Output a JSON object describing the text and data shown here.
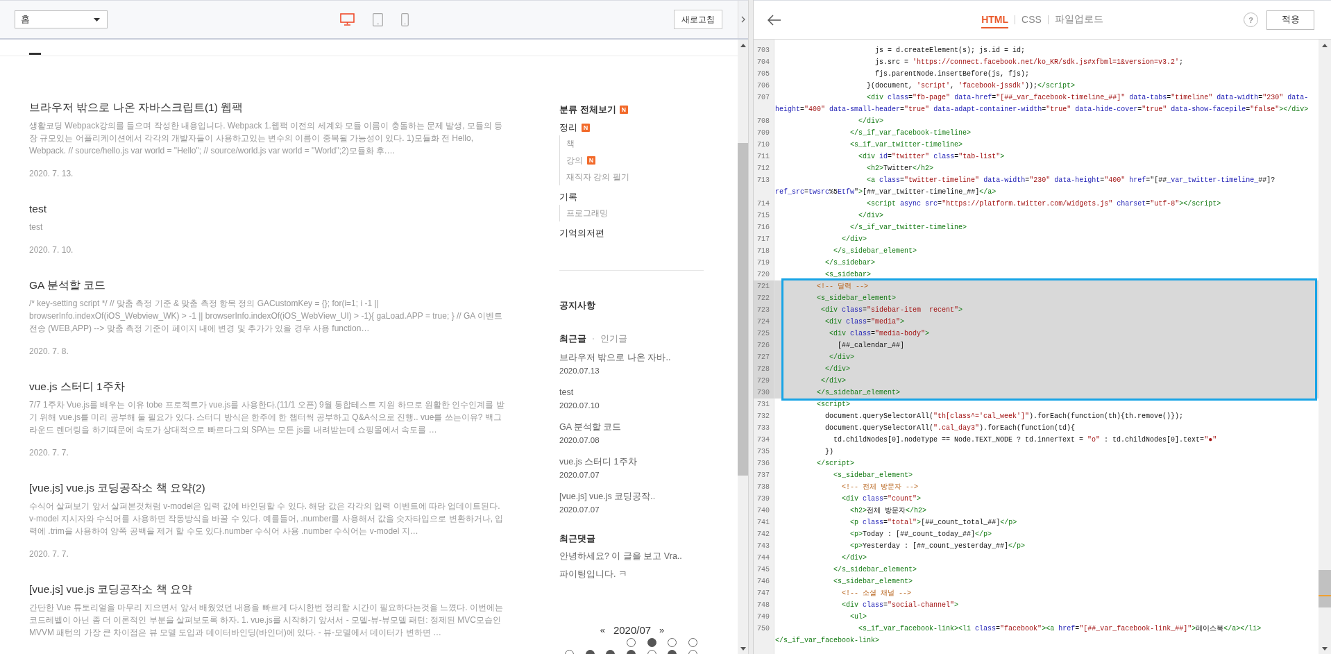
{
  "preview": {
    "page_select": {
      "value": "홈"
    },
    "devices": [
      {
        "kind": "desktop",
        "selected": true
      },
      {
        "kind": "tablet",
        "selected": false
      },
      {
        "kind": "mobile",
        "selected": false
      }
    ],
    "refresh_button": "새로고침",
    "posts": [
      {
        "title": "브라우저 밖으로 나온 자바스크립트(1) 웹팩",
        "excerpt": "생활코딩 Webpack강의를 들으며 작성한 내용입니다. Webpack 1.웹팩 이전의 세계와 모듈 이름이 충돌하는 문제 발생, 모듈의 등장 규모있는 어플리케이션에서 각각의 개발자들이 사용하고있는 변수의 이름이 중복될 가능성이 있다. 1)모듈화 전 Hello, Webpack. // source/hello.js var world = \"Hello\"; // source/world.js var world = \"World\";2)모듈화 후.…",
        "date": "2020. 7. 13."
      },
      {
        "title": "test",
        "excerpt": "test",
        "date": "2020. 7. 10."
      },
      {
        "title": "GA 분석할 코드",
        "excerpt": "/* key-setting script */ // 맞춤 측정 기준 & 맞춤 측정 항목 정의 GACustomKey = {}; for(i=1; i -1 || browserInfo.indexOf(iOS_Webview_WK) > -1 || browserInfo.indexOf(iOS_WebView_UI) > -1){ gaLoad.APP = true; } // GA 이벤트 전송 (WEB,APP) --> 맞춤 측정 기준이 페이지 내에 변경 및 추가가 있을 경우 사용 function…",
        "date": "2020. 7. 8."
      },
      {
        "title": "vue.js 스터디 1주차",
        "excerpt": "7/7 1주차 Vue.js를 배우는 이유 tobe 프로젝트가 vue.js를 사용한다.(11/1 오픈) 9월 통합테스트 지원 하므로 원활한 인수인계를 받기 위해 vue.js를 미리 공부해 둘 필요가 있다. 스터디 방식은 한주에 한 챕터씩 공부하고 Q&A식으로 진행.. vue를 쓰는이유? 백그라운드 렌더링을 하기때문에 속도가 상대적으로 빠르다그외 SPA는 모든 js를 내려받는데 쇼핑몰에서 속도를 …",
        "date": "2020. 7. 7."
      },
      {
        "title": "[vue.js] vue.js 코딩공작소 책 요약(2)",
        "excerpt": "수식어 살펴보기 앞서 살펴본것처럼 v-model은 입력 값에 바인딩할 수 있다. 해당 값은 각각의 입력 이벤트에 따라 업데이트된다. v-model 지시자와 수식어를 사용하면 작동방식을 바꿀 수 있다. 예를들어, .number를 사용해서 값을 숫자타입으로 변환하거나, 입력에 .trim을 사용하여 양쪽 공백을 제거 할 수도 있다.number 수식어 사용 .number 수식어는 v-model 지…",
        "date": "2020. 7. 7."
      },
      {
        "title": "[vue.js] vue.js 코딩공작소 책 요약",
        "excerpt": "간단한 Vue 튜토리얼을 마무리 지으면서 앞서 배웠었던 내용을 빠르게 다시한번 정리할 시간이 필요하다는것을 느꼈다. 이번에는 코드레벨이 아닌 좀 더 이론적인 부분을 살펴보도록 하자. 1. vue.js를 시작하기 앞서서 - 모델-뷰-뷰모델 패턴: 정제된 MVC모습인 MVVM 패턴의 가장 큰 차이점은 뷰 모델 도입과 데이터바인딩(바인더)에 있다. - 뷰-모델에서 데이터가 변하면 …"
      }
    ],
    "sidebar": {
      "category_root": {
        "label": "분류 전체보기",
        "badge": "N"
      },
      "categories": [
        {
          "label": "정리",
          "badge": "N",
          "children": [
            {
              "label": "책"
            },
            {
              "label": "강의",
              "badge": "N"
            },
            {
              "label": "재직자 강의 필기"
            }
          ]
        },
        {
          "label": "기록",
          "children": [
            {
              "label": "프로그래밍"
            }
          ]
        },
        {
          "label": "기억의저편"
        }
      ],
      "notice_heading": "공지사항",
      "post_tabs": [
        {
          "label": "최근글",
          "selected": true
        },
        {
          "label": "인기글",
          "selected": false
        }
      ],
      "recent_posts": [
        {
          "title": "브라우저 밖으로 나온 자바..",
          "date": "2020.07.13"
        },
        {
          "title": "test",
          "date": "2020.07.10"
        },
        {
          "title": "GA 분석할 코드",
          "date": "2020.07.08"
        },
        {
          "title": "vue.js 스터디 1주차",
          "date": "2020.07.07"
        },
        {
          "title": "[vue.js] vue.js 코딩공작..",
          "date": "2020.07.07"
        }
      ],
      "comments_heading": "최근댓글",
      "comments": [
        "안녕하세요? 이 글을 보고 Vra..",
        "파이팅입니다. ㅋ"
      ],
      "calendar": {
        "prev": "«",
        "month": "2020/07",
        "next": "»",
        "weeks": [
          [
            {
              "kind": "blank"
            },
            {
              "kind": "blank"
            },
            {
              "kind": "blank"
            },
            {
              "kind": "day",
              "filled": false
            },
            {
              "kind": "day",
              "filled": true
            },
            {
              "kind": "day",
              "filled": false
            },
            {
              "kind": "day",
              "filled": false
            }
          ],
          [
            {
              "kind": "day",
              "filled": false
            },
            {
              "kind": "day",
              "filled": true
            },
            {
              "kind": "day",
              "filled": true
            },
            {
              "kind": "day",
              "filled": true
            },
            {
              "kind": "day",
              "filled": false
            },
            {
              "kind": "day",
              "filled": true
            },
            {
              "kind": "day",
              "filled": false
            }
          ]
        ]
      }
    }
  },
  "editor": {
    "tabs": [
      {
        "label": "HTML",
        "selected": true
      },
      {
        "label": "CSS",
        "selected": false
      },
      {
        "label": "파일업로드",
        "selected": false
      }
    ],
    "help_button": "?",
    "apply_button": "적용",
    "lines": [
      {
        "number": "703",
        "text": "                        js = d.createElement(s); js.id = id;",
        "selected": false
      },
      {
        "number": "704",
        "text": "                        js.src = 'https://connect.facebook.net/ko_KR/sdk.js#xfbml=1&version=v3.2';",
        "selected": false
      },
      {
        "number": "705",
        "text": "                        fjs.parentNode.insertBefore(js, fjs);",
        "selected": false
      },
      {
        "number": "706",
        "text": "                      }(document, 'script', 'facebook-jssdk'));</script>",
        "selected": false
      },
      {
        "number": "707",
        "text": "                      <div class=\"fb-page\" data-href=\"[##_var_facebook-timeline_##]\" data-tabs=\"timeline\" data-width=\"230\" data-",
        "wrapped": "height=\"400\" data-small-header=\"true\" data-adapt-container-width=\"true\" data-hide-cover=\"true\" data-show-facepile=\"false\"></div>",
        "selected": false
      },
      {
        "number": "708",
        "text": "                    </div>",
        "selected": false
      },
      {
        "number": "709",
        "text": "                  </s_if_var_facebook-timeline>",
        "selected": false
      },
      {
        "number": "710",
        "text": "                  <s_if_var_twitter-timeline>",
        "selected": false
      },
      {
        "number": "711",
        "text": "                    <div id=\"twitter\" class=\"tab-list\">",
        "selected": false
      },
      {
        "number": "712",
        "text": "                      <h2>Twitter</h2>",
        "selected": false
      },
      {
        "number": "713",
        "text": "                      <a class=\"twitter-timeline\" data-width=\"230\" data-height=\"400\" href=\"[##_var_twitter-timeline_##]?",
        "wrapped": "ref_src=twsrc%5Etfw\">[##_var_twitter-timeline_##]</a>",
        "selected": false
      },
      {
        "number": "714",
        "text": "                      <script async src=\"https://platform.twitter.com/widgets.js\" charset=\"utf-8\"></script>",
        "selected": false
      },
      {
        "number": "715",
        "text": "                    </div>",
        "selected": false
      },
      {
        "number": "716",
        "text": "                  </s_if_var_twitter-timeline>",
        "selected": false
      },
      {
        "number": "717",
        "text": "                </div>",
        "selected": false
      },
      {
        "number": "718",
        "text": "              </s_sidebar_element>",
        "selected": false
      },
      {
        "number": "719",
        "text": "            </s_sidebar>",
        "selected": false
      },
      {
        "number": "720",
        "text": "            <s_sidebar>",
        "selected": false
      },
      {
        "number": "721",
        "text": "          <!-- 달력 -->",
        "selected": true,
        "boxed": true
      },
      {
        "number": "722",
        "text": "          <s_sidebar_element>",
        "selected": true,
        "boxed": true
      },
      {
        "number": "723",
        "text": "           <div class=\"sidebar-item  recent\">",
        "selected": true,
        "boxed": true
      },
      {
        "number": "724",
        "text": "            <div class=\"media\">",
        "selected": true,
        "boxed": true
      },
      {
        "number": "725",
        "text": "             <div class=\"media-body\">",
        "selected": true,
        "boxed": true
      },
      {
        "number": "726",
        "text": "               [##_calendar_##]",
        "selected": true,
        "boxed": true
      },
      {
        "number": "727",
        "text": "             </div>",
        "selected": true,
        "boxed": true
      },
      {
        "number": "728",
        "text": "            </div>",
        "selected": true,
        "boxed": true
      },
      {
        "number": "729",
        "text": "           </div>",
        "selected": true,
        "boxed": true
      },
      {
        "number": "730",
        "text": "          </s_sidebar_element>",
        "selected": true,
        "boxed": true
      },
      {
        "number": "731",
        "text": "          <script>",
        "selected": false
      },
      {
        "number": "732",
        "text": "            document.querySelectorAll(\"th[class^='cal_week']\").forEach(function(th){th.remove()});",
        "selected": false
      },
      {
        "number": "733",
        "text": "            document.querySelectorAll(\".cal_day3\").forEach(function(td){",
        "selected": false
      },
      {
        "number": "734",
        "text": "              td.childNodes[0].nodeType == Node.TEXT_NODE ? td.innerText = \"o\" : td.childNodes[0].text=\"●\"",
        "selected": false
      },
      {
        "number": "735",
        "text": "            })",
        "selected": false
      },
      {
        "number": "736",
        "text": "          </script>",
        "selected": false
      },
      {
        "number": "737",
        "text": "              <s_sidebar_element>",
        "selected": false
      },
      {
        "number": "738",
        "text": "                <!-- 전체 방문자 -->",
        "selected": false
      },
      {
        "number": "739",
        "text": "                <div class=\"count\">",
        "selected": false
      },
      {
        "number": "740",
        "text": "                  <h2>전체 방문자</h2>",
        "selected": false
      },
      {
        "number": "741",
        "text": "                  <p class=\"total\">[##_count_total_##]</p>",
        "selected": false
      },
      {
        "number": "742",
        "text": "                  <p>Today : [##_count_today_##]</p>",
        "selected": false
      },
      {
        "number": "743",
        "text": "                  <p>Yesterday : [##_count_yesterday_##]</p>",
        "selected": false
      },
      {
        "number": "744",
        "text": "                </div>",
        "selected": false
      },
      {
        "number": "745",
        "text": "              </s_sidebar_element>",
        "selected": false
      },
      {
        "number": "746",
        "text": "              <s_sidebar_element>",
        "selected": false
      },
      {
        "number": "747",
        "text": "                <!-- 소셜 채널 -->",
        "selected": false
      },
      {
        "number": "748",
        "text": "                <div class=\"social-channel\">",
        "selected": false
      },
      {
        "number": "749",
        "text": "                  <ul>",
        "selected": false
      },
      {
        "number": "750",
        "text": "                    <s_if_var_facebook-link><li class=\"facebook\"><a href=\"[##_var_facebook-link_##]\">페이스북</a></li>",
        "wrapped": "</s_if_var_facebook-link>",
        "selected": false
      }
    ]
  }
}
